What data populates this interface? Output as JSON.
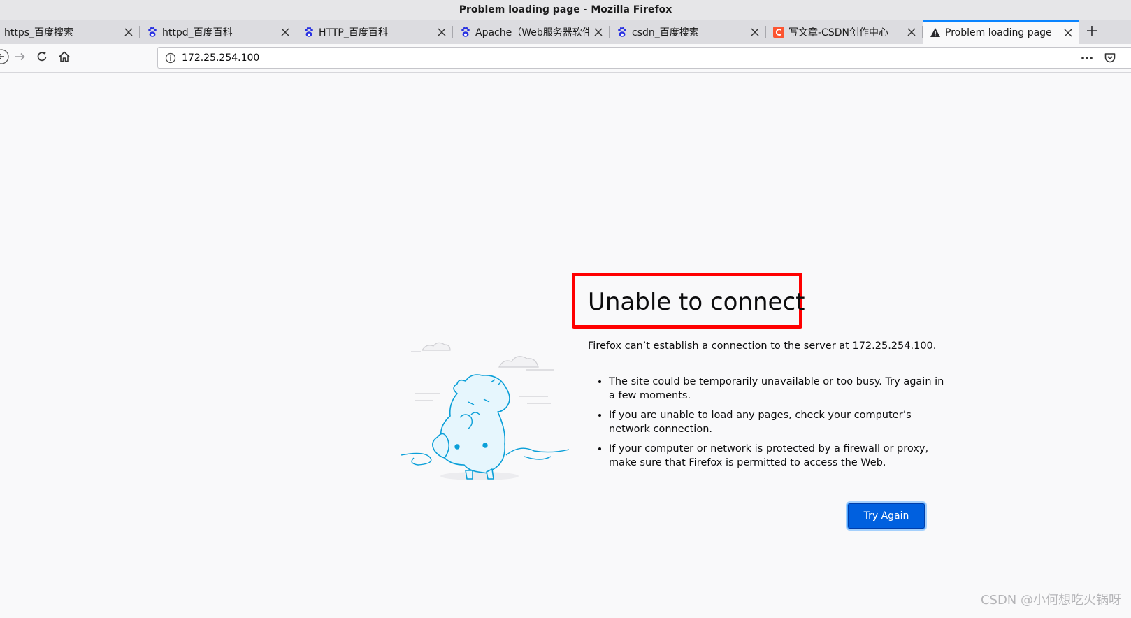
{
  "window": {
    "title": "Problem loading page - Mozilla Firefox"
  },
  "tabs": [
    {
      "label": "https_百度搜索",
      "favicon": "none",
      "active": false
    },
    {
      "label": "httpd_百度百科",
      "favicon": "baidu-paw-icon",
      "active": false
    },
    {
      "label": "HTTP_百度百科",
      "favicon": "baidu-paw-icon",
      "active": false
    },
    {
      "label": "Apache（Web服务器软件",
      "favicon": "baidu-paw-icon",
      "active": false
    },
    {
      "label": "csdn_百度搜索",
      "favicon": "baidu-paw-icon",
      "active": false
    },
    {
      "label": "写文章-CSDN创作中心",
      "favicon": "csdn-c-icon",
      "active": false
    },
    {
      "label": "Problem loading page",
      "favicon": "warning-icon",
      "active": true
    }
  ],
  "navbar": {
    "url": "172.25.254.100"
  },
  "error": {
    "title": "Unable to connect",
    "description": "Firefox can’t establish a connection to the server at 172.25.254.100.",
    "bullets": [
      "The site could be temporarily unavailable or too busy. Try again in a few moments.",
      "If you are unable to load any pages, check your computer’s network connection.",
      "If your computer or network is protected by a firewall or proxy, make sure that Firefox is permitted to access the Web."
    ],
    "button_label": "Try Again"
  },
  "watermark": "CSDN @小何想吃火锅呀",
  "colors": {
    "accent": "#0060df",
    "highlight_box": "#ff0000",
    "csdn_brand": "#fc5531",
    "baidu_brand": "#2932e1"
  }
}
